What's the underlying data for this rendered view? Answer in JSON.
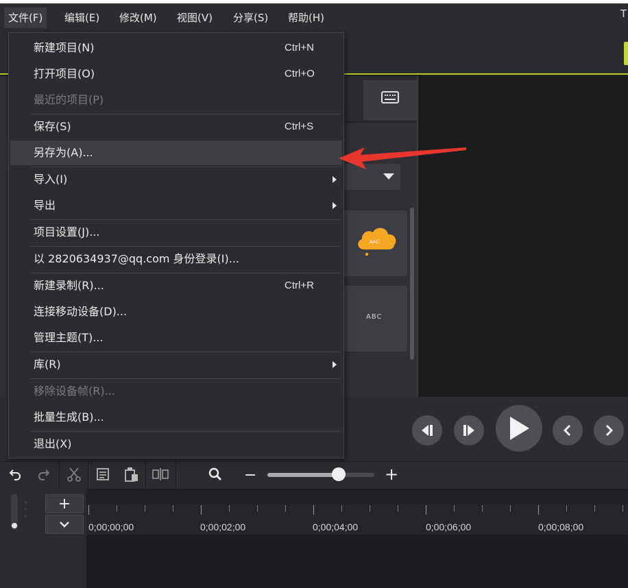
{
  "menubar": {
    "items": [
      {
        "label": "文件(F)",
        "active": true
      },
      {
        "label": "编辑(E)"
      },
      {
        "label": "修改(M)"
      },
      {
        "label": "视图(V)"
      },
      {
        "label": "分享(S)"
      },
      {
        "label": "帮助(H)"
      }
    ],
    "cut_text": "T"
  },
  "file_menu": {
    "items": [
      {
        "label": "新建项目(N)",
        "shortcut": "Ctrl+N"
      },
      {
        "label": "打开项目(O)",
        "shortcut": "Ctrl+O"
      },
      {
        "label": "最近的项目(P)",
        "disabled": true
      },
      {
        "label": "保存(S)",
        "shortcut": "Ctrl+S"
      },
      {
        "label": "另存为(A)...",
        "highlighted": true
      },
      {
        "label": "导入(I)",
        "submenu": true
      },
      {
        "label": "导出",
        "submenu": true
      },
      {
        "label": "项目设置(J)..."
      },
      {
        "label": "以 2820634937@qq.com 身份登录(I)..."
      },
      {
        "label": "新建录制(R)...",
        "shortcut": "Ctrl+R"
      },
      {
        "label": "连接移动设备(D)..."
      },
      {
        "label": "管理主题(T)..."
      },
      {
        "label": "库(R)",
        "submenu": true
      },
      {
        "label": "移除设备帧(R)...",
        "disabled": true
      },
      {
        "label": "批量生成(B)..."
      },
      {
        "label": "退出(X)"
      }
    ]
  },
  "media_thumbs": {
    "cloud_text": "AAC",
    "abc_text": "ABC"
  },
  "timeline": {
    "add_label": "+",
    "ruler_labels": [
      "0;00;00;00",
      "0;00;02;00",
      "0;00;04;00",
      "0;00;06;00",
      "0;00;08;00"
    ],
    "zoom_level": 0.67
  },
  "colors": {
    "menu_bg": "#2b2c30",
    "accent_green": "#c4d43a",
    "cloud_orange": "#f5a623",
    "arrow_red": "#e8362f"
  },
  "icons": [
    "keyboard-icon",
    "dropdown-caret-icon",
    "cloud-icon",
    "prev-frame-icon",
    "next-frame-icon",
    "play-icon",
    "prev-marker-icon",
    "next-marker-icon",
    "undo-icon",
    "redo-icon",
    "scissors-icon",
    "copy-icon",
    "paste-icon",
    "split-icon",
    "magnifier-icon"
  ]
}
